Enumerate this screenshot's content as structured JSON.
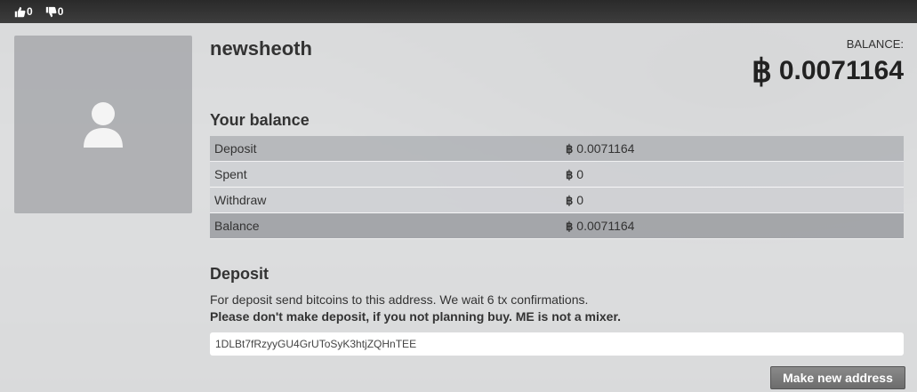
{
  "topbar": {
    "likes": "0",
    "dislikes": "0"
  },
  "profile": {
    "username": "newsheoth"
  },
  "header_balance": {
    "label": "BALANCE:",
    "symbol": "฿",
    "amount": "0.0071164"
  },
  "your_balance": {
    "title": "Your balance",
    "rows": [
      {
        "label": "Deposit",
        "symbol": "฿",
        "value": "0.0071164"
      },
      {
        "label": "Spent",
        "symbol": "฿",
        "value": "0"
      },
      {
        "label": "Withdraw",
        "symbol": "฿",
        "value": "0"
      },
      {
        "label": "Balance",
        "symbol": "฿",
        "value": "0.0071164"
      }
    ]
  },
  "deposit": {
    "title": "Deposit",
    "info": "For deposit send bitcoins to this address. We wait 6 tx confirmations.",
    "warning": "Please don't make deposit, if you not planning buy. ME is not a mixer.",
    "address": "1DLBt7fRzyyGU4GrUToSyK3htjZQHnTEE",
    "new_address_button": "Make new address"
  }
}
